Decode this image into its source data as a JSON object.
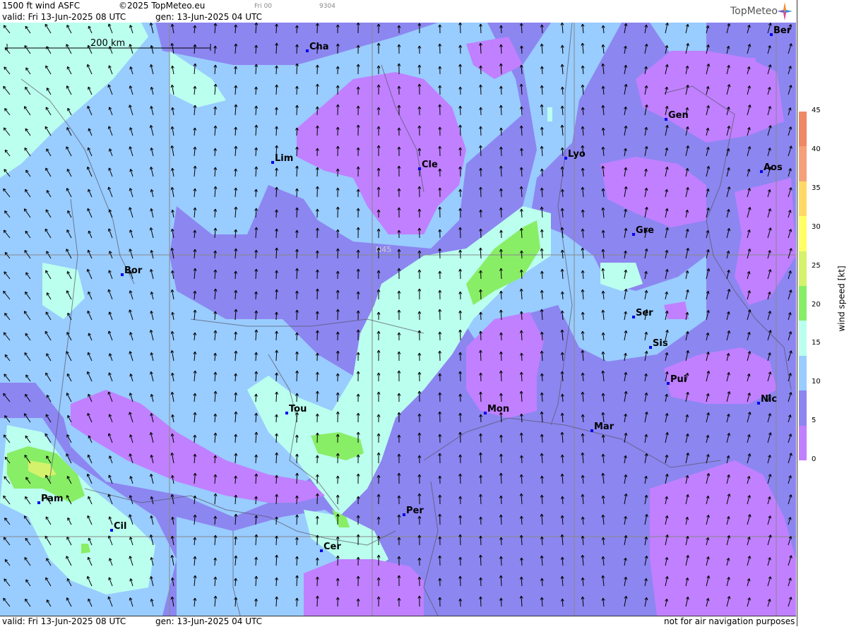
{
  "header": {
    "title": "1500 ft wind ASFC",
    "copyright": "©2025 TopMeteo.eu",
    "run_code": "Fri 00",
    "id_code": "9304",
    "valid": "valid:  Fri  13-Jun-2025  08 UTC",
    "gen": "gen: 13-Jun-2025 04 UTC",
    "logo": "TopMeteo"
  },
  "footer": {
    "valid": "valid:  Fri  13-Jun-2025  08 UTC",
    "gen": "gen: 13-Jun-2025 04 UTC",
    "disclaimer": "not for air navigation purposes"
  },
  "scale_bar": {
    "label": "200 km"
  },
  "latitude_label": "N45",
  "legend": {
    "title": "wind speed [kt]",
    "ticks": [
      "45",
      "40",
      "35",
      "30",
      "25",
      "20",
      "15",
      "10",
      "5",
      "0"
    ],
    "colors": [
      "#ee8866",
      "#f5a07a",
      "#ffd966",
      "#ffff66",
      "#d4f26b",
      "#88ee66",
      "#bbffee",
      "#99ccff",
      "#8c86f0",
      "#c080ff"
    ]
  },
  "cities": [
    {
      "name": "Cha"
    },
    {
      "name": "Ber"
    },
    {
      "name": "Lim"
    },
    {
      "name": "Cle"
    },
    {
      "name": "Lyo"
    },
    {
      "name": "Gen"
    },
    {
      "name": "Aos"
    },
    {
      "name": "Gre"
    },
    {
      "name": "Bor"
    },
    {
      "name": "Ser"
    },
    {
      "name": "Sis"
    },
    {
      "name": "Pui"
    },
    {
      "name": "Nic"
    },
    {
      "name": "Tou"
    },
    {
      "name": "Mon"
    },
    {
      "name": "Mar"
    },
    {
      "name": "Pam"
    },
    {
      "name": "Cil"
    },
    {
      "name": "Per"
    },
    {
      "name": "Cer"
    }
  ]
}
